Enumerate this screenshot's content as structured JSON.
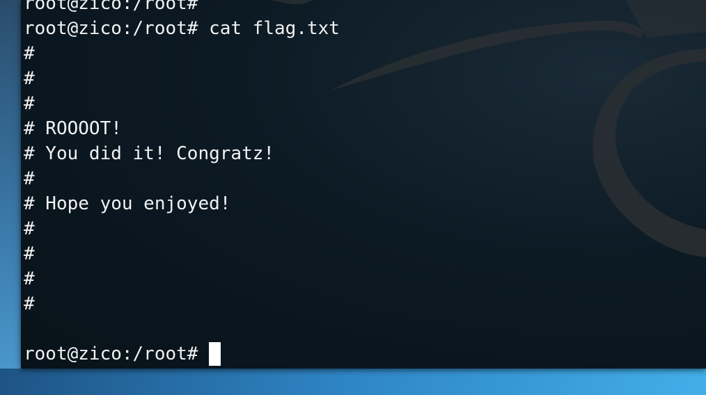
{
  "terminal": {
    "lines": [
      "root@zico:/root#",
      "root@zico:/root# cat flag.txt",
      "#",
      "#",
      "#",
      "# ROOOOT!",
      "# You did it! Congratz!",
      "#",
      "# Hope you enjoyed!",
      "#",
      "#",
      "#",
      "#",
      ""
    ],
    "prompt": "root@zico:/root# ",
    "colors": {
      "text": "#f2f2f2",
      "background": "#0c1a24",
      "cursor": "#ffffff"
    }
  },
  "wallpaper": {
    "icon": "kali-dragon-logo-icon"
  }
}
